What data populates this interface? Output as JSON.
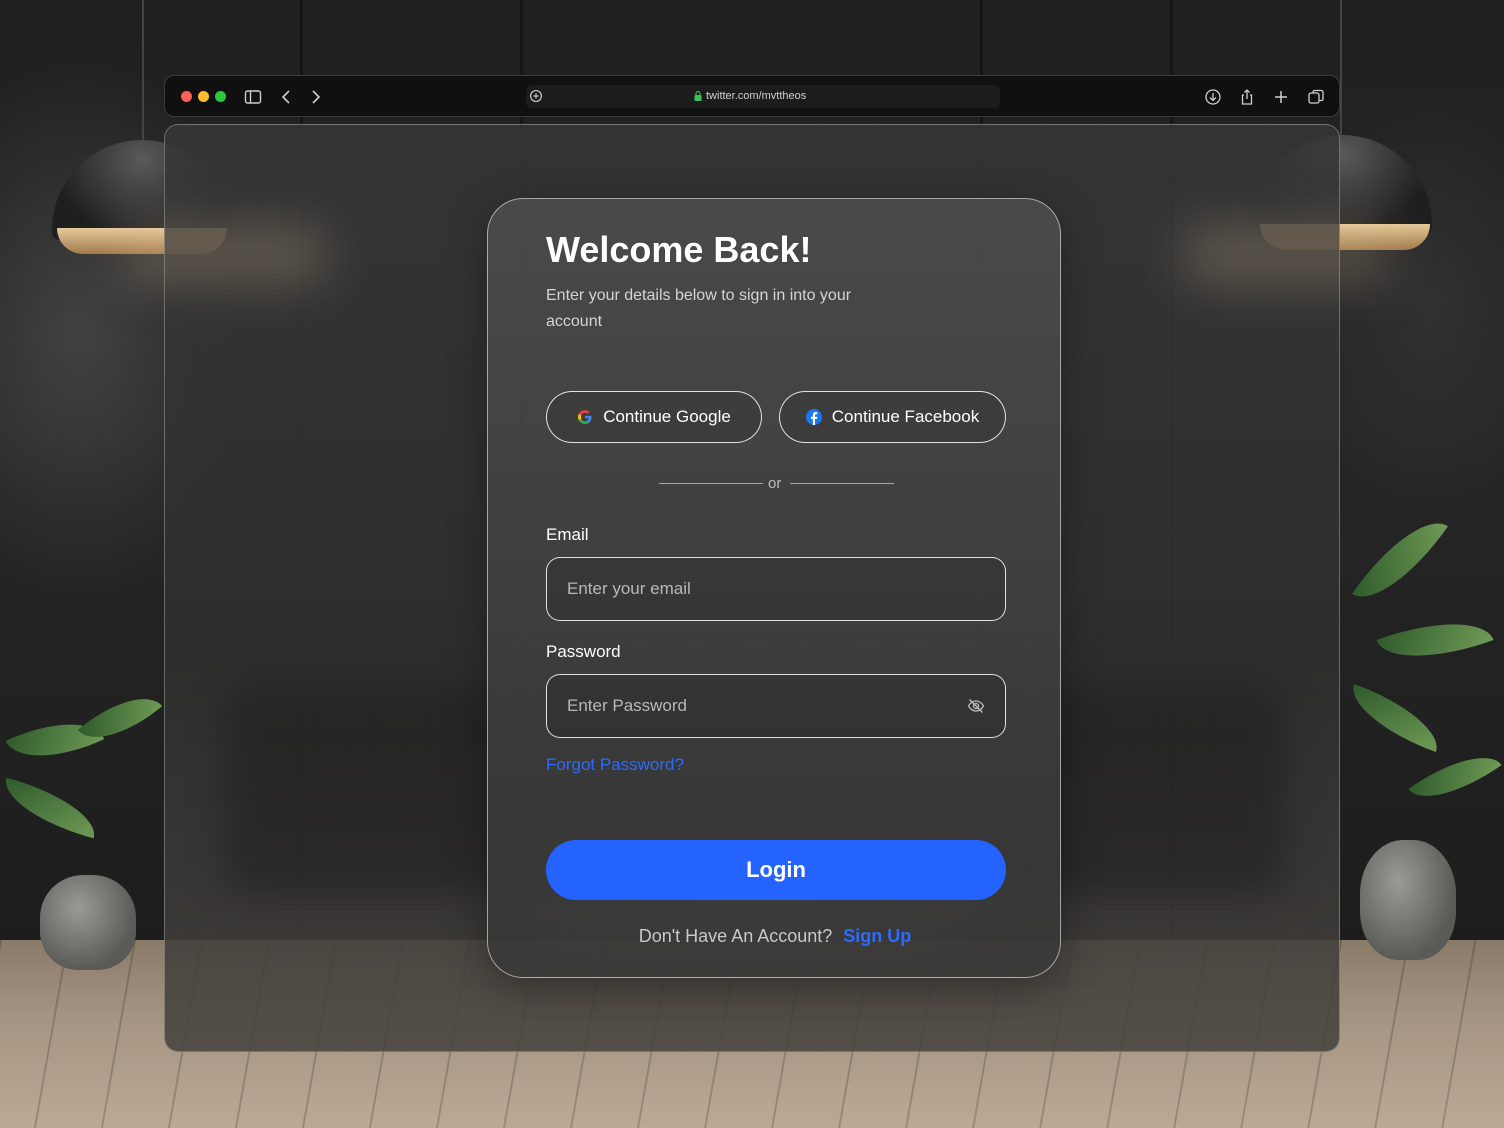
{
  "browser": {
    "url": "twitter.com/mvttheos",
    "traffic_colors": [
      "#ff5f57",
      "#febc2e",
      "#28c840"
    ],
    "left_icons": [
      "sidebar-icon",
      "back-chevron-icon",
      "forward-chevron-icon"
    ],
    "right_icons": [
      "download-icon",
      "share-icon",
      "new-tab-plus-icon",
      "tabs-overview-icon"
    ]
  },
  "login": {
    "title": "Welcome Back!",
    "subtitle": "Enter your details below to sign in into your account",
    "google_label": "Continue Google",
    "facebook_label": "Continue Facebook",
    "divider_text": "or",
    "email_label": "Email",
    "email_placeholder": "Enter your email",
    "password_label": "Password",
    "password_placeholder": "Enter Password",
    "forgot_label": "Forgot Password?",
    "login_label": "Login",
    "signup_prompt": "Don't Have An Account?",
    "signup_label": "Sign Up"
  },
  "colors": {
    "accent": "#2563ff",
    "link": "#2b6bff",
    "facebook": "#1877f2"
  }
}
